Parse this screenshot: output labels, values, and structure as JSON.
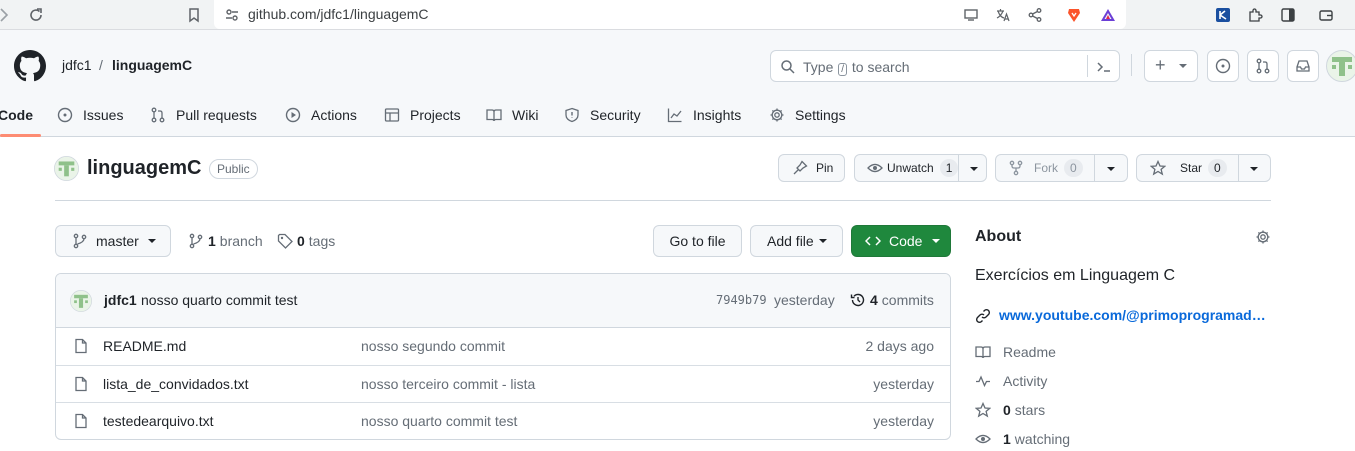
{
  "browser": {
    "url": "github.com/jdfc1/linguagemC"
  },
  "header": {
    "owner": "jdfc1",
    "separator": "/",
    "repo": "linguagemC",
    "search": {
      "prefix": "Type",
      "key": "/",
      "suffix": "to search"
    },
    "plus_label": "+"
  },
  "nav": {
    "tabs": [
      {
        "label": "Code",
        "icon": "code-icon",
        "active": true
      },
      {
        "label": "Issues",
        "icon": "issue-icon"
      },
      {
        "label": "Pull requests",
        "icon": "pull-request-icon"
      },
      {
        "label": "Actions",
        "icon": "play-icon"
      },
      {
        "label": "Projects",
        "icon": "table-icon"
      },
      {
        "label": "Wiki",
        "icon": "book-icon"
      },
      {
        "label": "Security",
        "icon": "shield-icon"
      },
      {
        "label": "Insights",
        "icon": "graph-icon"
      },
      {
        "label": "Settings",
        "icon": "gear-icon"
      }
    ]
  },
  "repo": {
    "name": "linguagemC",
    "visibility": "Public",
    "pin_label": "Pin",
    "unwatch_label": "Unwatch",
    "watch_count": "1",
    "fork_label": "Fork",
    "fork_count": "0",
    "star_label": "Star",
    "star_count": "0"
  },
  "branch_bar": {
    "branch": "master",
    "branch_count": "1",
    "branch_word": "branch",
    "tag_count": "0",
    "tag_word": "tags",
    "go_to_file": "Go to file",
    "add_file": "Add file",
    "code_label": "Code"
  },
  "latest_commit": {
    "author": "jdfc1",
    "message": "nosso quarto commit test",
    "sha": "7949b79",
    "time": "yesterday",
    "commit_count": "4",
    "commit_word": "commits"
  },
  "files": [
    {
      "name": "README.md",
      "message": "nosso segundo commit",
      "time": "2 days ago"
    },
    {
      "name": "lista_de_convidados.txt",
      "message": "nosso terceiro commit - lista",
      "time": "yesterday"
    },
    {
      "name": "testedearquivo.txt",
      "message": "nosso quarto commit test",
      "time": "yesterday"
    }
  ],
  "about": {
    "title": "About",
    "description": "Exercícios em Linguagem C",
    "link": "www.youtube.com/@primoprogramad…",
    "readme": "Readme",
    "activity": "Activity",
    "stars_count": "0",
    "stars_word": "stars",
    "watching_count": "1",
    "watching_word": "watching"
  },
  "colors": {
    "accent_green": "#1f883d",
    "tab_underline": "#fd8c73",
    "link_blue": "#0969da",
    "avatar_green": "#8fc18a"
  }
}
